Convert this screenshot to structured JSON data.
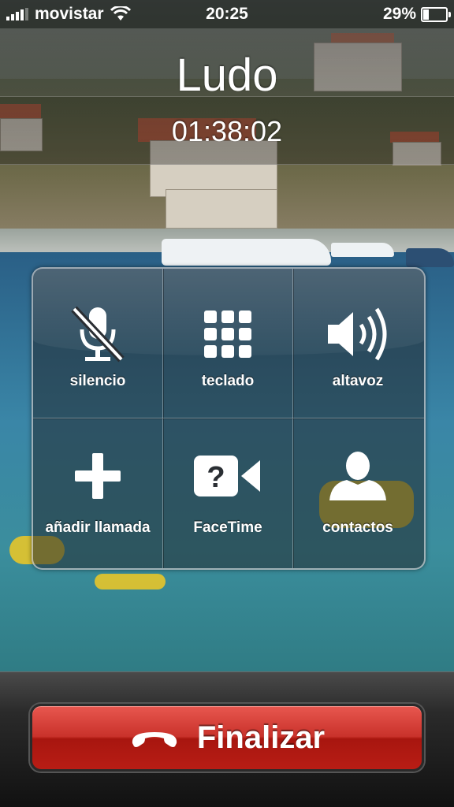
{
  "status_bar": {
    "carrier": "movistar",
    "time": "20:25",
    "battery_percent": "29%",
    "battery_level": 0.29,
    "icons": [
      "signal-icon",
      "wifi-icon",
      "battery-icon"
    ]
  },
  "call": {
    "caller_name": "Ludo",
    "duration": "01:38:02"
  },
  "controls": {
    "mute": {
      "label": "silencio",
      "icon": "microphone-muted-icon"
    },
    "keypad": {
      "label": "teclado",
      "icon": "keypad-icon"
    },
    "speaker": {
      "label": "altavoz",
      "icon": "speaker-icon"
    },
    "add_call": {
      "label": "añadir llamada",
      "icon": "plus-icon"
    },
    "facetime": {
      "label": "FaceTime",
      "icon": "facetime-unavailable-icon"
    },
    "contacts": {
      "label": "contactos",
      "icon": "contact-silhouette-icon"
    }
  },
  "end_call": {
    "label": "Finalizar",
    "icon": "hang-up-icon",
    "color": "#c9322b"
  }
}
